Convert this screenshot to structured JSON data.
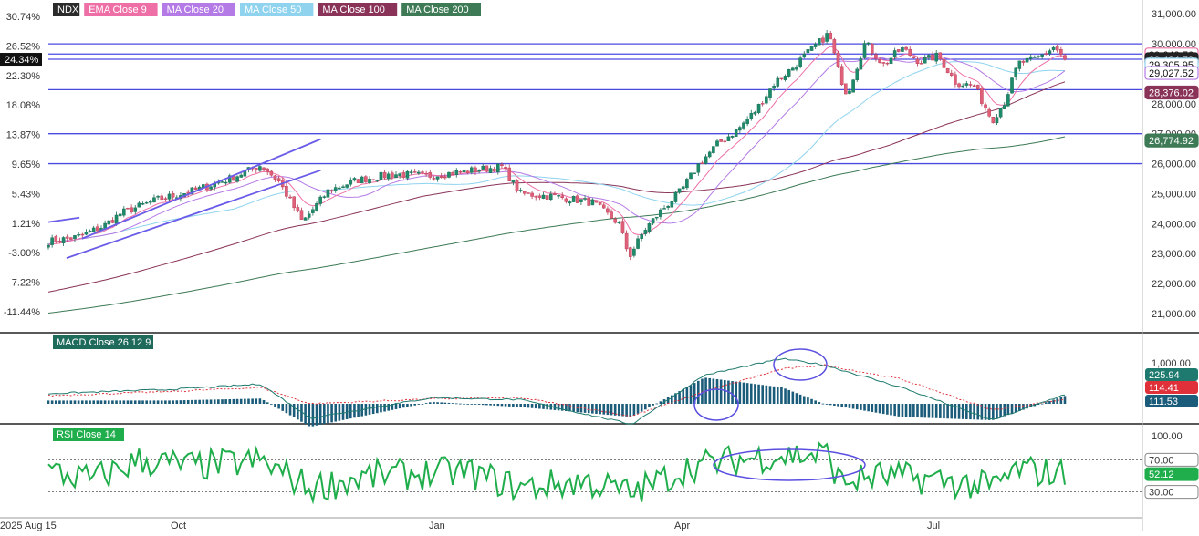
{
  "chart_data": [
    {
      "type": "candlestick",
      "panel": "price",
      "symbol": "NDX",
      "legend": [
        "NDX",
        "EMA Close 9",
        "MA Close 20",
        "MA Close 50",
        "MA Close 100",
        "MA Close 200"
      ],
      "legend_colors": [
        "#2b2b2b",
        "#ee6fa6",
        "#b47ae6",
        "#8fd3ef",
        "#8a3358",
        "#3d7a55"
      ],
      "right_axis_ticks": [
        "31,000.00",
        "30,000.00",
        "29,000.00",
        "28,000.00",
        "27,000.00",
        "26,000.00",
        "25,000.00",
        "24,000.00",
        "23,000.00",
        "22,000.00",
        "21,000.00"
      ],
      "right_axis_values": [
        31000,
        30000,
        29000,
        28000,
        27000,
        26000,
        25000,
        24000,
        23000,
        22000,
        21000
      ],
      "left_axis_ticks": [
        "30.74%",
        "26.52%",
        "22.30%",
        "18.08%",
        "13.87%",
        "9.65%",
        "5.43%",
        "1.21%",
        "-3.00%",
        "-7.22%",
        "-11.44%"
      ],
      "ylim": [
        20450,
        31250
      ],
      "x_labels": [
        "2025 Aug 15",
        "Oct",
        "Jan",
        "Apr",
        "Jul"
      ],
      "price_labels": [
        {
          "text": "29,642.76",
          "value": 29642.76,
          "color": "#ee6fa6"
        },
        {
          "text": "29,484.73",
          "value": 29484.73,
          "color": "#222222"
        },
        {
          "text": "29,305.95",
          "value": 29305.95,
          "color": "#8fd3ef"
        },
        {
          "text": "29,027.52",
          "value": 29027.52,
          "color": "#b47ae6"
        },
        {
          "text": "28,376.02",
          "value": 28376.02,
          "color": "#8a3358"
        },
        {
          "text": "26,774.92",
          "value": 26774.92,
          "color": "#3d7a55"
        }
      ],
      "left_marker": "24.34%",
      "horizontal_levels": [
        30000,
        29660,
        29484.73,
        28470,
        27000,
        26000
      ],
      "trend_lines": [
        {
          "from": [
            "2025 Aug 15",
            24050
          ],
          "to": [
            "2025 Aug 27",
            24200
          ]
        },
        {
          "from": [
            "2025 Aug 28",
            23500
          ],
          "to": [
            "2025 Nov 28",
            26820
          ]
        },
        {
          "from": [
            "2025 Aug 22",
            22850
          ],
          "to": [
            "2025 Nov 28",
            25780
          ]
        }
      ],
      "series_path": [
        [
          "2025 Aug 15",
          23400
        ],
        [
          "2025 Aug 26",
          23550
        ],
        [
          "2025 Sep 5",
          23900
        ],
        [
          "2025 Sep 12",
          24350
        ],
        [
          "2025 Sep 26",
          24800
        ],
        [
          "2025 Oct 10",
          25100
        ],
        [
          "2025 Oct 24",
          25500
        ],
        [
          "2025 Nov 5",
          25950
        ],
        [
          "2025 Nov 12",
          25400
        ],
        [
          "2025 Nov 21",
          24050
        ],
        [
          "2025 Dec 1",
          25100
        ],
        [
          "2025 Dec 12",
          25450
        ],
        [
          "2025 Dec 26",
          25650
        ],
        [
          "2026 Jan 9",
          25600
        ],
        [
          "2026 Jan 23",
          25750
        ],
        [
          "2026 Feb 6",
          25900
        ],
        [
          "2026 Feb 13",
          25000
        ],
        [
          "2026 Feb 27",
          24900
        ],
        [
          "2026 Mar 13",
          24700
        ],
        [
          "2026 Mar 23",
          24000
        ],
        [
          "2026 Mar 27",
          22900
        ],
        [
          "2026 Apr 2",
          23800
        ],
        [
          "2026 Apr 8",
          24400
        ],
        [
          "2026 Apr 16",
          25100
        ],
        [
          "2026 Apr 23",
          26000
        ],
        [
          "2026 Apr 30",
          26650
        ],
        [
          "2026 May 8",
          27150
        ],
        [
          "2026 May 15",
          27800
        ],
        [
          "2026 May 22",
          28700
        ],
        [
          "2026 May 29",
          29200
        ],
        [
          "2026 Jun 5",
          29800
        ],
        [
          "2026 Jun 12",
          30350
        ],
        [
          "2026 Jun 16",
          29000
        ],
        [
          "2026 Jun 19",
          28300
        ],
        [
          "2026 Jun 26",
          30050
        ],
        [
          "2026 Jul 3",
          29300
        ],
        [
          "2026 Jul 10",
          29850
        ],
        [
          "2026 Jul 17",
          29400
        ],
        [
          "2026 Jul 24",
          29600
        ],
        [
          "2026 Jul 31",
          28700
        ],
        [
          "2026 Aug 7",
          28600
        ],
        [
          "2026 Aug 14",
          27450
        ],
        [
          "2026 Aug 19",
          28100
        ],
        [
          "2026 Aug 24",
          29350
        ],
        [
          "2026 Aug 31",
          29500
        ],
        [
          "2026 Sep 7",
          29900
        ],
        [
          "2026 Sep 11",
          29485
        ]
      ],
      "grid": false
    },
    {
      "type": "line",
      "panel": "macd",
      "legend": [
        "MACD Close 26 12 9"
      ],
      "axis_ticks": [
        "1,000.00"
      ],
      "price_labels": [
        {
          "text": "225.94",
          "value": 225.94,
          "color": "#1e7a6e"
        },
        {
          "text": "114.41",
          "value": 114.41,
          "color": "#e0313a"
        },
        {
          "text": "111.53",
          "value": 111.53,
          "color": "#1a5c7a"
        }
      ],
      "series": [
        {
          "name": "MACD",
          "color": "#1e7a6e",
          "points": [
            [
              "2025 Aug 15",
              250
            ],
            [
              "2025 Oct 1",
              350
            ],
            [
              "2025 Nov 5",
              480
            ],
            [
              "2025 Nov 24",
              -350
            ],
            [
              "2026 Jan 10",
              150
            ],
            [
              "2026 Feb 13",
              100
            ],
            [
              "2026 Mar 28",
              -500
            ],
            [
              "2026 Apr 25",
              700
            ],
            [
              "2026 May 25",
              1100
            ],
            [
              "2026 Jun 10",
              950
            ],
            [
              "2026 Jul 10",
              400
            ],
            [
              "2026 Aug 14",
              -400
            ],
            [
              "2026 Sep 11",
              230
            ]
          ]
        },
        {
          "name": "Signal",
          "color": "#e0313a",
          "points": [
            [
              "2025 Aug 15",
              200
            ],
            [
              "2025 Oct 1",
              300
            ],
            [
              "2025 Nov 5",
              400
            ],
            [
              "2025 Nov 24",
              0
            ],
            [
              "2026 Jan 10",
              120
            ],
            [
              "2026 Feb 13",
              150
            ],
            [
              "2026 Mar 28",
              -300
            ],
            [
              "2026 Apr 25",
              300
            ],
            [
              "2026 May 25",
              850
            ],
            [
              "2026 Jun 10",
              950
            ],
            [
              "2026 Jul 10",
              600
            ],
            [
              "2026 Aug 14",
              -150
            ],
            [
              "2026 Sep 11",
              110
            ]
          ]
        }
      ]
    },
    {
      "type": "line",
      "panel": "rsi",
      "legend": [
        "RSI Close 14"
      ],
      "axis_ticks": [
        "100.00"
      ],
      "price_labels": [
        {
          "text": "70.00",
          "value": 70,
          "color": "#ffffff"
        },
        {
          "text": "52.12",
          "value": 52.12,
          "color": "#1fae4b"
        },
        {
          "text": "30.00",
          "value": 30,
          "color": "#ffffff"
        }
      ],
      "ylim": [
        0,
        100
      ],
      "series": [
        {
          "name": "RSI",
          "color": "#1fae4b",
          "points": [
            [
              "2025 Aug 15",
              55
            ],
            [
              "2025 Sep 1",
              45
            ],
            [
              "2025 Sep 19",
              69
            ],
            [
              "2025 Oct 10",
              62
            ],
            [
              "2025 Nov 5",
              68
            ],
            [
              "2025 Nov 24",
              35
            ],
            [
              "2025 Dec 18",
              50
            ],
            [
              "2026 Jan 23",
              55
            ],
            [
              "2026 Feb 13",
              35
            ],
            [
              "2026 Mar 10",
              43
            ],
            [
              "2026 Mar 28",
              28
            ],
            [
              "2026 Apr 20",
              62
            ],
            [
              "2026 May 20",
              75
            ],
            [
              "2026 Jun 12",
              77
            ],
            [
              "2026 Jun 16",
              42
            ],
            [
              "2026 Jul 1",
              50
            ],
            [
              "2026 Jul 24",
              45
            ],
            [
              "2026 Aug 14",
              35
            ],
            [
              "2026 Aug 24",
              58
            ],
            [
              "2026 Sep 11",
              52
            ]
          ]
        }
      ]
    }
  ]
}
